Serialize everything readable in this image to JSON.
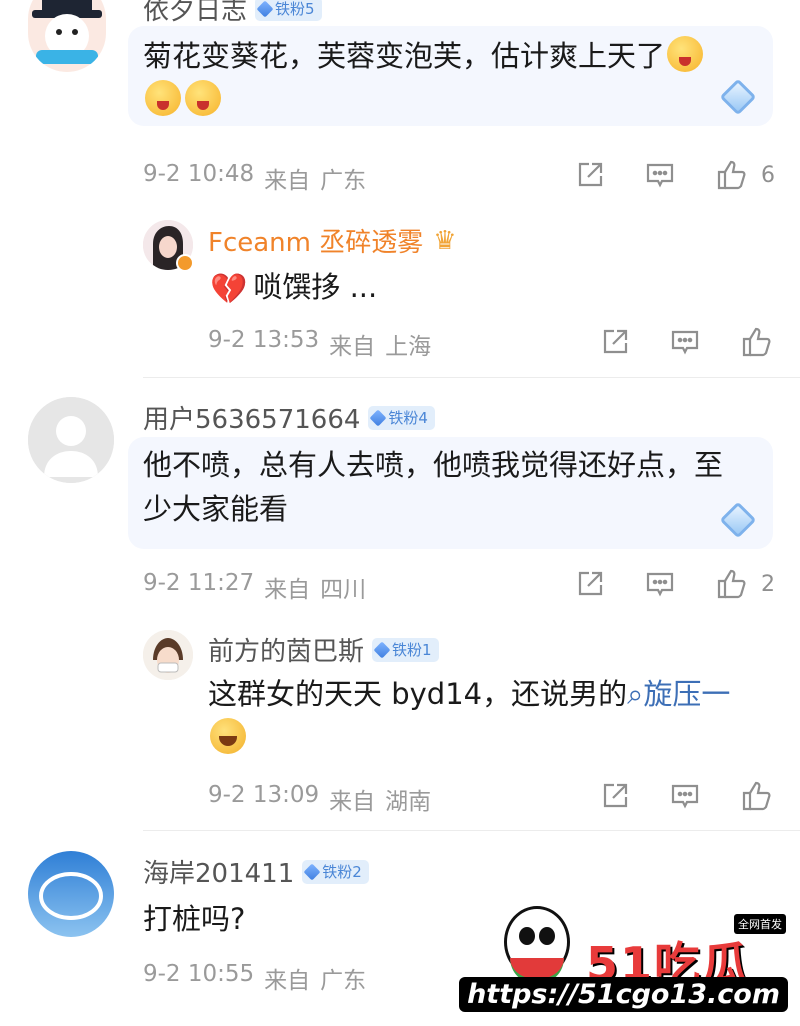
{
  "comments": [
    {
      "user": "依夕日志",
      "badge": "铁粉5",
      "text": "菊花变葵花，芙蓉变泡芙，估计爽上天了",
      "time": "9-2 10:48",
      "location_prefix": "来自",
      "location": "广东",
      "likes": "6",
      "reply": {
        "user": "Fceanm 丞碎透雾",
        "text": "唢馔拸 ...",
        "time": "9-2 13:53",
        "location_prefix": "来自",
        "location": "上海"
      }
    },
    {
      "user": "用户5636571664",
      "badge": "铁粉4",
      "text_line1": "他不喷，总有人去喷，他喷我觉得还好点，至",
      "text_line2": "少大家能看",
      "time": "9-2 11:27",
      "location_prefix": "来自",
      "location": "四川",
      "likes": "2",
      "reply": {
        "user": "前方的茵巴斯",
        "badge": "铁粉1",
        "text": "这群女的天天 byd14，还说男的",
        "search_text": "旋压一",
        "time": "9-2 13:09",
        "location_prefix": "来自",
        "location": "湖南"
      }
    },
    {
      "user": "海岸201411",
      "badge": "铁粉2",
      "text": "打桩吗?",
      "time": "9-2 10:55",
      "location_prefix": "来自",
      "location": "广东"
    }
  ],
  "watermark": {
    "title": "51吃瓜",
    "tag": "全网首发",
    "url": "https://51cgo13.com"
  },
  "icons": [
    "share-icon",
    "comment-icon",
    "like-icon",
    "diamond-icon",
    "search-icon"
  ]
}
